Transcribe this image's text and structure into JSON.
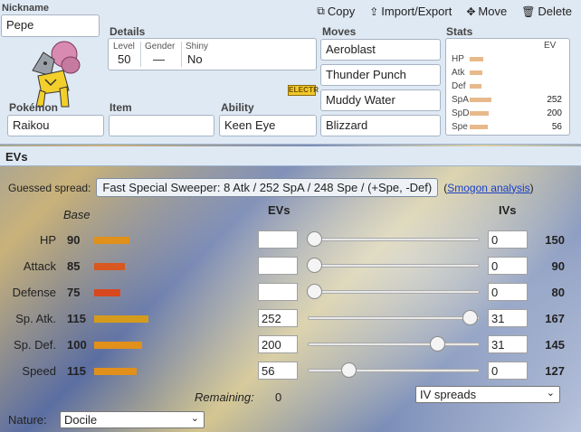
{
  "toolbar": {
    "copy": "Copy",
    "import_export": "Import/Export",
    "move": "Move",
    "delete": "Delete"
  },
  "labels": {
    "nickname": "Nickname",
    "details": "Details",
    "moves": "Moves",
    "stats": "Stats",
    "pokemon": "Pokémon",
    "item": "Item",
    "ability": "Ability"
  },
  "nickname": "Pepe",
  "details": {
    "level_label": "Level",
    "level": "50",
    "gender_label": "Gender",
    "gender": "—",
    "shiny_label": "Shiny",
    "shiny": "No"
  },
  "type_badge": "ELECTR",
  "pokemon": "Raikou",
  "item": "",
  "ability": "Keen Eye",
  "moves": [
    "Aeroblast",
    "Thunder Punch",
    "Muddy Water",
    "Blizzard"
  ],
  "stats_box": {
    "ev_label": "EV",
    "rows": [
      {
        "name": "HP",
        "ev": "",
        "bar": 0.3
      },
      {
        "name": "Atk",
        "ev": "",
        "bar": 0.28
      },
      {
        "name": "Def",
        "ev": "",
        "bar": 0.25
      },
      {
        "name": "SpA",
        "ev": "252",
        "bar": 0.48
      },
      {
        "name": "SpD",
        "ev": "200",
        "bar": 0.42
      },
      {
        "name": "Spe",
        "ev": "56",
        "bar": 0.4
      }
    ]
  },
  "evs_section": {
    "title": "EVs",
    "guessed_label": "Guessed spread:",
    "guessed_value": "Fast Special Sweeper: 8 Atk / 252 SpA / 248 Spe / (+Spe, -Def)",
    "smogon_open": "(",
    "smogon_link": "Smogon analysis",
    "smogon_close": ")",
    "base_header": "Base",
    "evs_header": "EVs",
    "ivs_header": "IVs",
    "rows": [
      {
        "name": "HP",
        "base": "90",
        "bar_color": "#e0901b",
        "bar_frac": 0.52,
        "ev": "",
        "slider": 0.0,
        "iv": "0",
        "total": "150"
      },
      {
        "name": "Attack",
        "base": "85",
        "bar_color": "#d8581f",
        "bar_frac": 0.45,
        "ev": "",
        "slider": 0.0,
        "iv": "0",
        "total": "90"
      },
      {
        "name": "Defense",
        "base": "75",
        "bar_color": "#d8481f",
        "bar_frac": 0.39,
        "ev": "",
        "slider": 0.0,
        "iv": "0",
        "total": "80"
      },
      {
        "name": "Sp. Atk.",
        "base": "115",
        "bar_color": "#d49b1d",
        "bar_frac": 0.8,
        "ev": "252",
        "slider": 1.0,
        "iv": "31",
        "total": "167"
      },
      {
        "name": "Sp. Def.",
        "base": "100",
        "bar_color": "#e0901b",
        "bar_frac": 0.7,
        "ev": "200",
        "slider": 0.79,
        "iv": "31",
        "total": "145"
      },
      {
        "name": "Speed",
        "base": "115",
        "bar_color": "#e0901b",
        "bar_frac": 0.62,
        "ev": "56",
        "slider": 0.22,
        "iv": "0",
        "total": "127"
      }
    ],
    "remaining_label": "Remaining:",
    "remaining_value": "0",
    "iv_spreads_select": "IV spreads",
    "nature_label": "Nature:",
    "nature_value": "Docile"
  }
}
